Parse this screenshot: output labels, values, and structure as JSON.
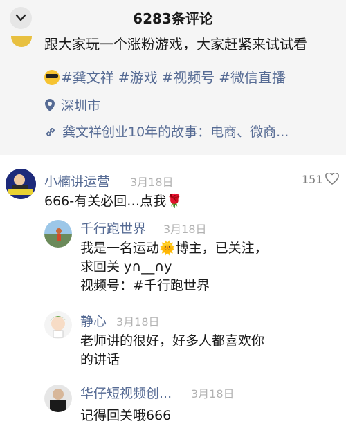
{
  "header": {
    "title": "6283条评论"
  },
  "post": {
    "text_line": "跟大家玩一个涨粉游戏，大家赶紧来试试看",
    "tags": [
      "#龚文祥",
      "#游戏",
      "#视频号",
      "#微信直播"
    ],
    "location": "深圳市",
    "link": "龚文祥创业10年的故事：电商、微商..."
  },
  "comments": [
    {
      "user": "小楠讲运营",
      "date": "3月18日",
      "likes": "151",
      "text": "666-有关必回…点我🌹"
    },
    {
      "user": "千行跑世界",
      "date": "3月18日",
      "text_lines": [
        "我是一名运动🌞博主，已关注，",
        "求回关 y∩__∩y",
        "视频号：#千行跑世界"
      ]
    },
    {
      "user": "静心",
      "date": "3月18日",
      "text_lines": [
        "老师讲的很好，好多人都喜欢你",
        "的讲话"
      ]
    },
    {
      "user": "华仔短视频创...",
      "date": "3月18日",
      "text": "记得回关哦666"
    }
  ],
  "colors": {
    "link": "#566b94",
    "muted": "#b2b2b2",
    "bg_post": "#f5f5f5"
  }
}
